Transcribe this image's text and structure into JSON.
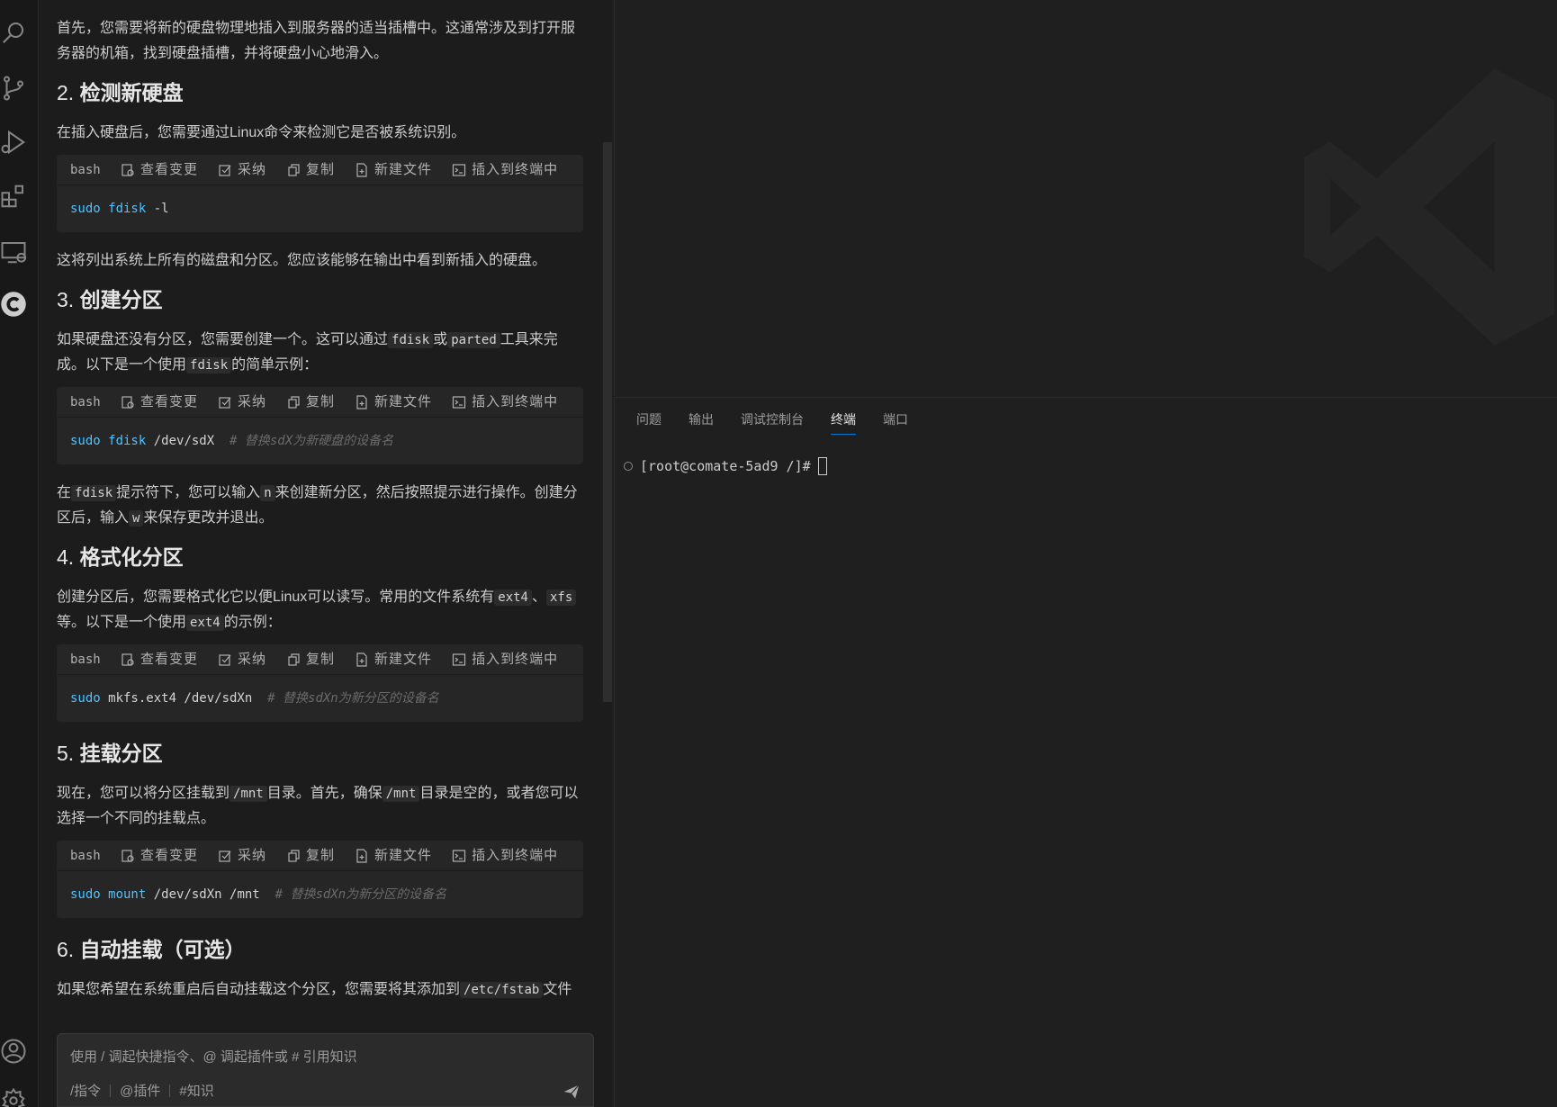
{
  "activity_bar": {
    "icons": [
      "search-icon",
      "source-control-icon",
      "run-debug-icon",
      "extensions-icon",
      "remote-explorer-icon",
      "comate-icon",
      "account-icon",
      "settings-gear-icon"
    ]
  },
  "chat": {
    "intro": "首先，您需要将新的硬盘物理地插入到服务器的适当插槽中。这通常涉及到打开服务器的机箱，找到硬盘插槽，并将硬盘小心地滑入。",
    "code_toolbar": {
      "lang": "bash",
      "view_changes": "查看变更",
      "accept": "采纳",
      "copy": "复制",
      "new_file": "新建文件",
      "insert_terminal": "插入到终端中"
    },
    "s2": {
      "num": "2.",
      "title": "检测新硬盘",
      "p1": "在插入硬盘后，您需要通过Linux命令来检测它是否被系统识别。",
      "code_kw": "sudo fdisk",
      "code_rest": " -l",
      "p2": "这将列出系统上所有的磁盘和分区。您应该能够在输出中看到新插入的硬盘。"
    },
    "s3": {
      "num": "3.",
      "title": "创建分区",
      "p1a": "如果硬盘还没有分区，您需要创建一个。这可以通过",
      "c1": "fdisk",
      "p1b": "或",
      "c2": "parted",
      "p1c": "工具来完成。以下是一个使用",
      "c3": "fdisk",
      "p1d": "的简单示例：",
      "code_kw": "sudo fdisk",
      "code_rest": " /dev/sdX  ",
      "code_cm": "# 替换sdX为新硬盘的设备名",
      "p2a": "在",
      "c4": "fdisk",
      "p2b": "提示符下，您可以输入",
      "c5": "n",
      "p2c": "来创建新分区，然后按照提示进行操作。创建分区后，输入",
      "c6": "w",
      "p2d": "来保存更改并退出。"
    },
    "s4": {
      "num": "4.",
      "title": "格式化分区",
      "p1a": "创建分区后，您需要格式化它以便Linux可以读写。常用的文件系统有",
      "c1": "ext4",
      "p1b": "、",
      "c2": "xfs",
      "p1c": "等。以下是一个使用",
      "c3": "ext4",
      "p1d": "的示例：",
      "code_kw": "sudo",
      "code_rest": " mkfs.ext4 /dev/sdXn  ",
      "code_cm": "# 替换sdXn为新分区的设备名"
    },
    "s5": {
      "num": "5.",
      "title": "挂载分区",
      "p1a": "现在，您可以将分区挂载到",
      "c1": "/mnt",
      "p1b": "目录。首先，确保",
      "c2": "/mnt",
      "p1c": "目录是空的，或者您可以选择一个不同的挂载点。",
      "code_kw": "sudo mount",
      "code_rest": " /dev/sdXn /mnt  ",
      "code_cm": "# 替换sdXn为新分区的设备名"
    },
    "s6": {
      "num": "6.",
      "title": "自动挂载（可选）",
      "p1a": "如果您希望在系统重启后自动挂载这个分区，您需要将其添加到",
      "c1": "/etc/fstab",
      "p1b": "文件"
    },
    "input": {
      "placeholder": "使用 / 调起快捷指令、@ 调起插件或 # 引用知识",
      "tool_command": "/指令",
      "tool_plugin": "@插件",
      "tool_knowledge": "#知识"
    }
  },
  "panel": {
    "tabs": [
      "问题",
      "输出",
      "调试控制台",
      "终端",
      "端口"
    ],
    "active_tab": "终端",
    "terminal_prompt": "[root@comate-5ad9 /]#"
  }
}
